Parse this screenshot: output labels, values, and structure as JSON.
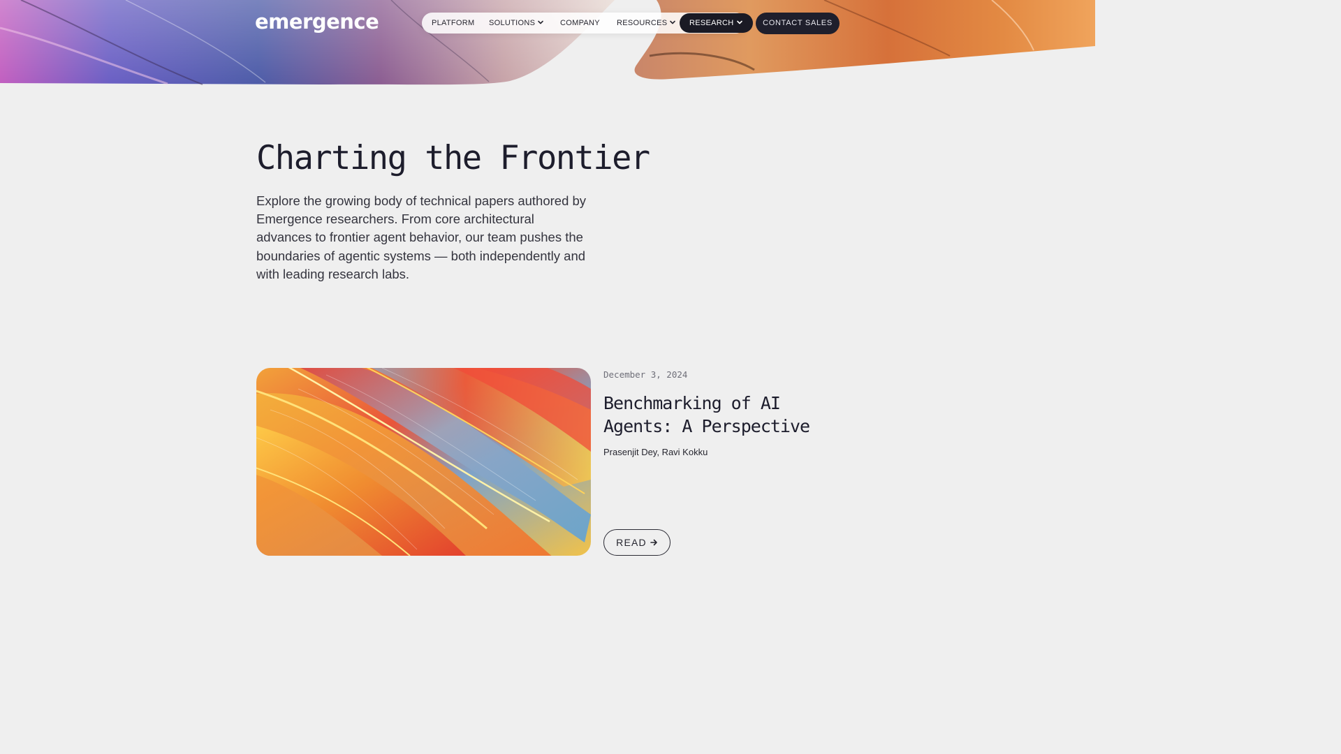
{
  "brand": {
    "logo_text": "emergence"
  },
  "nav": {
    "items": [
      {
        "label": "PLATFORM",
        "has_dropdown": false
      },
      {
        "label": "SOLUTIONS",
        "has_dropdown": true
      },
      {
        "label": "COMPANY",
        "has_dropdown": false
      },
      {
        "label": "RESOURCES",
        "has_dropdown": true
      },
      {
        "label": "RESEARCH",
        "has_dropdown": true,
        "active": true
      }
    ],
    "dropdown_icon": "chevron-down-icon",
    "active_color": "#1a1a24"
  },
  "header": {
    "contact_label": "CONTACT SALES"
  },
  "main": {
    "title": "Charting the Frontier",
    "intro": "Explore the growing body of technical papers authored by Emergence researchers. From core architectural advances to frontier agent behavior, our team pushes the boundaries of agentic systems — both independently and with leading research labs."
  },
  "articles": [
    {
      "date": "December 3, 2024",
      "title": "Benchmarking of AI Agents: A Perspective",
      "authors": "Prasenjit Dey, Ravi Kokku",
      "read_label": "READ",
      "read_icon": "arrow-right-icon"
    }
  ],
  "colors": {
    "background": "#efefef",
    "text_dark": "#1d1d2c",
    "button_dark": "#1f1f2c"
  }
}
